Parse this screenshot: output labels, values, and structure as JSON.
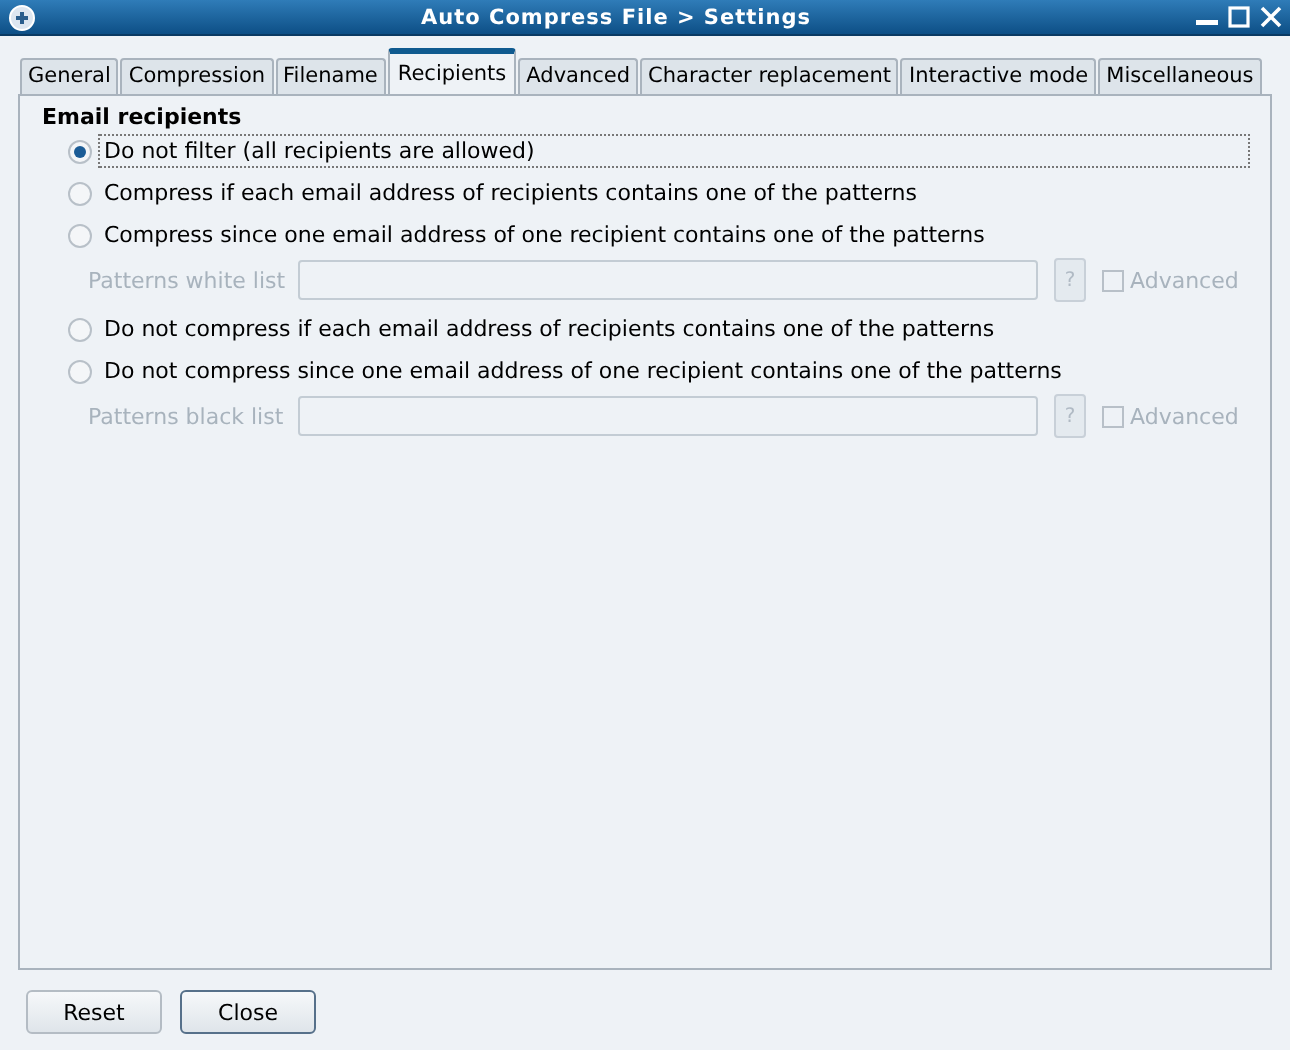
{
  "window": {
    "title": "Auto Compress File > Settings"
  },
  "tabs": [
    {
      "label": "General",
      "selected": false
    },
    {
      "label": "Compression",
      "selected": false
    },
    {
      "label": "Filename",
      "selected": false
    },
    {
      "label": "Recipients",
      "selected": true
    },
    {
      "label": "Advanced",
      "selected": false
    },
    {
      "label": "Character replacement",
      "selected": false
    },
    {
      "label": "Interactive mode",
      "selected": false
    },
    {
      "label": "Miscellaneous",
      "selected": false
    }
  ],
  "section": {
    "title": "Email recipients",
    "items": [
      {
        "kind": "radio",
        "label": "Do not filter (all recipients are allowed)",
        "selected": true,
        "focused": true
      },
      {
        "kind": "radio",
        "label": "Compress if each email address of recipients contains one of the patterns",
        "selected": false,
        "focused": false
      },
      {
        "kind": "radio",
        "label": "Compress since one email address of one recipient contains one of the patterns",
        "selected": false,
        "focused": false
      },
      {
        "kind": "patterns",
        "label": "Patterns white list",
        "disabled": true,
        "help": "?",
        "checkbox": {
          "label": "Advanced",
          "checked": false
        }
      },
      {
        "kind": "radio",
        "label": "Do not compress if each email address of recipients contains one of the patterns",
        "selected": false,
        "focused": false
      },
      {
        "kind": "radio",
        "label": "Do not compress since one email address of one recipient contains one of the patterns",
        "selected": false,
        "focused": false
      },
      {
        "kind": "patterns",
        "label": "Patterns black list",
        "disabled": true,
        "help": "?",
        "checkbox": {
          "label": "Advanced",
          "checked": false
        }
      }
    ]
  },
  "buttons": [
    {
      "label": "Reset",
      "default": false
    },
    {
      "label": "Close",
      "default": true
    }
  ]
}
